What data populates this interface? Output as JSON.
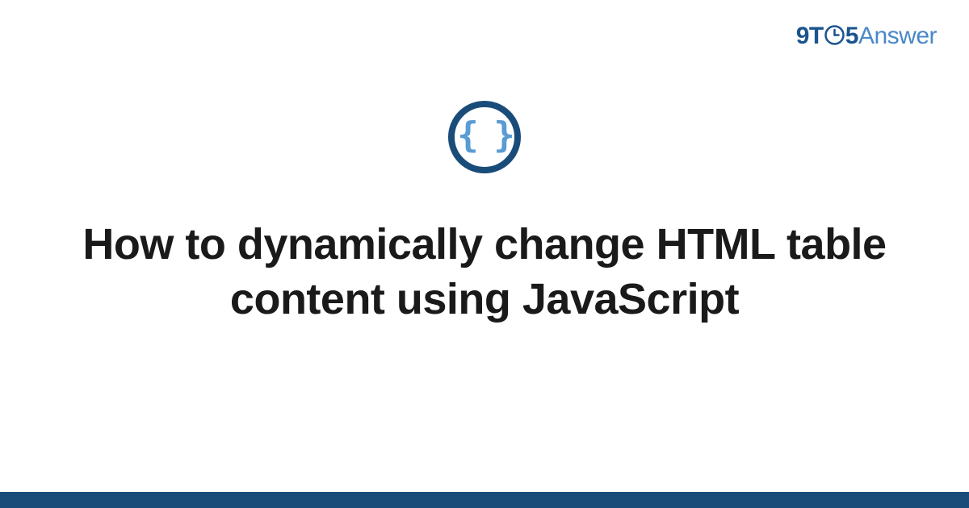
{
  "logo": {
    "part1": "9T",
    "part2": "5",
    "part3": "Answer"
  },
  "icon": {
    "braces": "{ }",
    "name": "code-braces-icon"
  },
  "title": "How to dynamically change HTML table content using JavaScript",
  "colors": {
    "dark_blue": "#1a4c7a",
    "mid_blue": "#1a5490",
    "light_blue": "#4a88c7",
    "brace_blue": "#5a9bd4"
  }
}
